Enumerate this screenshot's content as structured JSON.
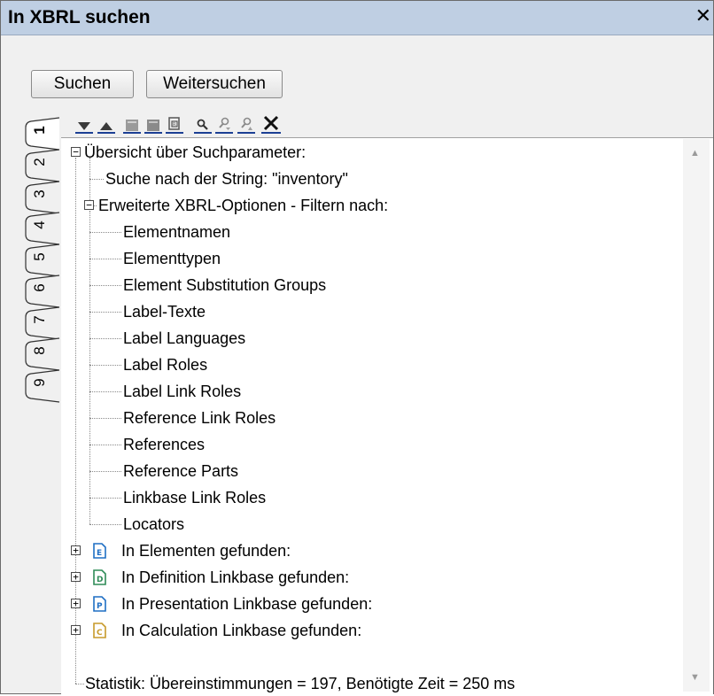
{
  "window": {
    "title": "In XBRL suchen",
    "close_glyph": "✕"
  },
  "buttons": {
    "search": "Suchen",
    "search_next": "Weitersuchen"
  },
  "toolbar": {
    "icons": [
      "move-down-icon",
      "move-up-icon",
      "collapse-icon",
      "expand-icon",
      "copy-icon",
      "find-icon",
      "find-previous-icon",
      "find-next-icon",
      "clear-icon"
    ]
  },
  "tabs": [
    "1",
    "2",
    "3",
    "4",
    "5",
    "6",
    "7",
    "8",
    "9"
  ],
  "active_tab": "1",
  "tree": {
    "summary": "Übersicht über Suchparameter:",
    "search_string": "Suche nach der String: \"inventory\"",
    "advanced": "Erweiterte XBRL-Optionen - Filtern nach:",
    "filters": [
      "Elementnamen",
      "Elementtypen",
      "Element Substitution Groups",
      "Label-Texte",
      "Label Languages",
      "Label Roles",
      "Label Link Roles",
      "Reference Link Roles",
      "References",
      "Reference Parts",
      "Linkbase Link Roles",
      "Locators"
    ],
    "found": [
      {
        "letter": "E",
        "label": "In Elementen gefunden:",
        "color": "#1f6fc4"
      },
      {
        "letter": "D",
        "label": "In Definition Linkbase gefunden:",
        "color": "#2e8b57"
      },
      {
        "letter": "P",
        "label": "In Presentation Linkbase gefunden:",
        "color": "#1f6fc4"
      },
      {
        "letter": "C",
        "label": "In Calculation Linkbase gefunden:",
        "color": "#c79a2a"
      }
    ],
    "stats": "Statistik: Übereinstimmungen = 197, Benötigte Zeit = 250 ms"
  }
}
